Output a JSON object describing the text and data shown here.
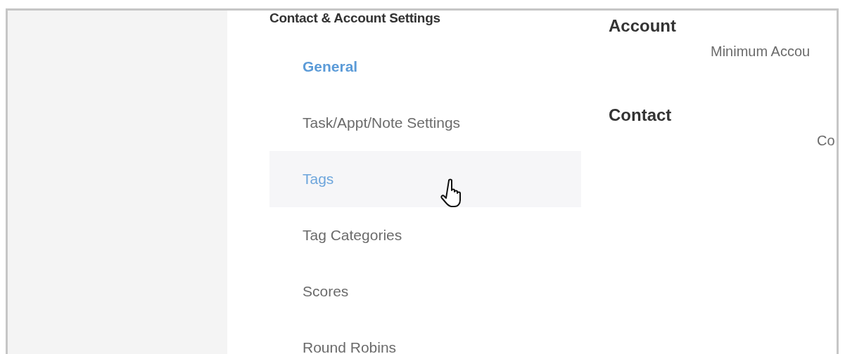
{
  "sidebar": {
    "heading": "Contact & Account Settings",
    "items": [
      {
        "label": "General",
        "selected": true,
        "hovered": false
      },
      {
        "label": "Task/Appt/Note Settings",
        "selected": false,
        "hovered": false
      },
      {
        "label": "Tags",
        "selected": false,
        "hovered": true
      },
      {
        "label": "Tag Categories",
        "selected": false,
        "hovered": false
      },
      {
        "label": "Scores",
        "selected": false,
        "hovered": false
      },
      {
        "label": "Round Robins",
        "selected": false,
        "hovered": false
      }
    ]
  },
  "sections": [
    {
      "title": "Account",
      "field_label": "Minimum Accou"
    },
    {
      "title": "Contact",
      "field_label": "Co"
    }
  ]
}
